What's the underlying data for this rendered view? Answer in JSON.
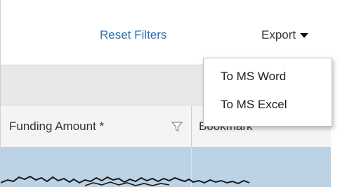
{
  "toolbar": {
    "reset_label": "Reset Filters",
    "export_label": "Export"
  },
  "export_menu": {
    "items": [
      {
        "label": "To MS Word"
      },
      {
        "label": "To MS Excel"
      }
    ]
  },
  "table": {
    "columns": [
      {
        "label": "Funding Amount *"
      },
      {
        "label": "Bookmark"
      }
    ]
  },
  "colors": {
    "link": "#2a6fb0",
    "selected_row": "#bcd3e6",
    "header_bg": "#f4f4f4",
    "band_bg": "#e8e8e8"
  },
  "icons": {
    "filter": "filter-icon",
    "caret": "caret-down-icon"
  }
}
